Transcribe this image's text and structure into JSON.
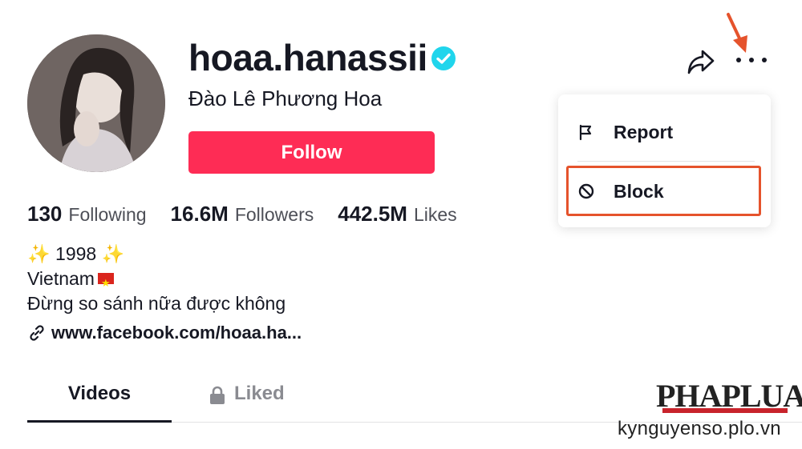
{
  "profile": {
    "username": "hoaa.hanassii",
    "display_name": "Đào Lê Phương Hoa",
    "verified": true,
    "follow_label": "Follow"
  },
  "stats": [
    {
      "value": "130",
      "label": "Following"
    },
    {
      "value": "16.6M",
      "label": "Followers"
    },
    {
      "value": "442.5M",
      "label": "Likes"
    }
  ],
  "bio": {
    "line1": "✨ 1998 ✨",
    "line2": "Vietnam",
    "line3": "Đừng so sánh nữa được không"
  },
  "link": "www.facebook.com/hoaa.ha...",
  "tabs": [
    {
      "label": "Videos",
      "active": true
    },
    {
      "label": "Liked",
      "locked": true
    }
  ],
  "menu": {
    "items": [
      {
        "label": "Report",
        "icon": "flag-icon"
      },
      {
        "label": "Block",
        "icon": "block-icon"
      }
    ]
  },
  "watermark": {
    "logo": "PHAPLUAT",
    "site": "kynguyenso.plo.vn"
  },
  "colors": {
    "accent": "#fe2c55",
    "verified": "#20d5ec",
    "highlight": "#e5532c"
  }
}
